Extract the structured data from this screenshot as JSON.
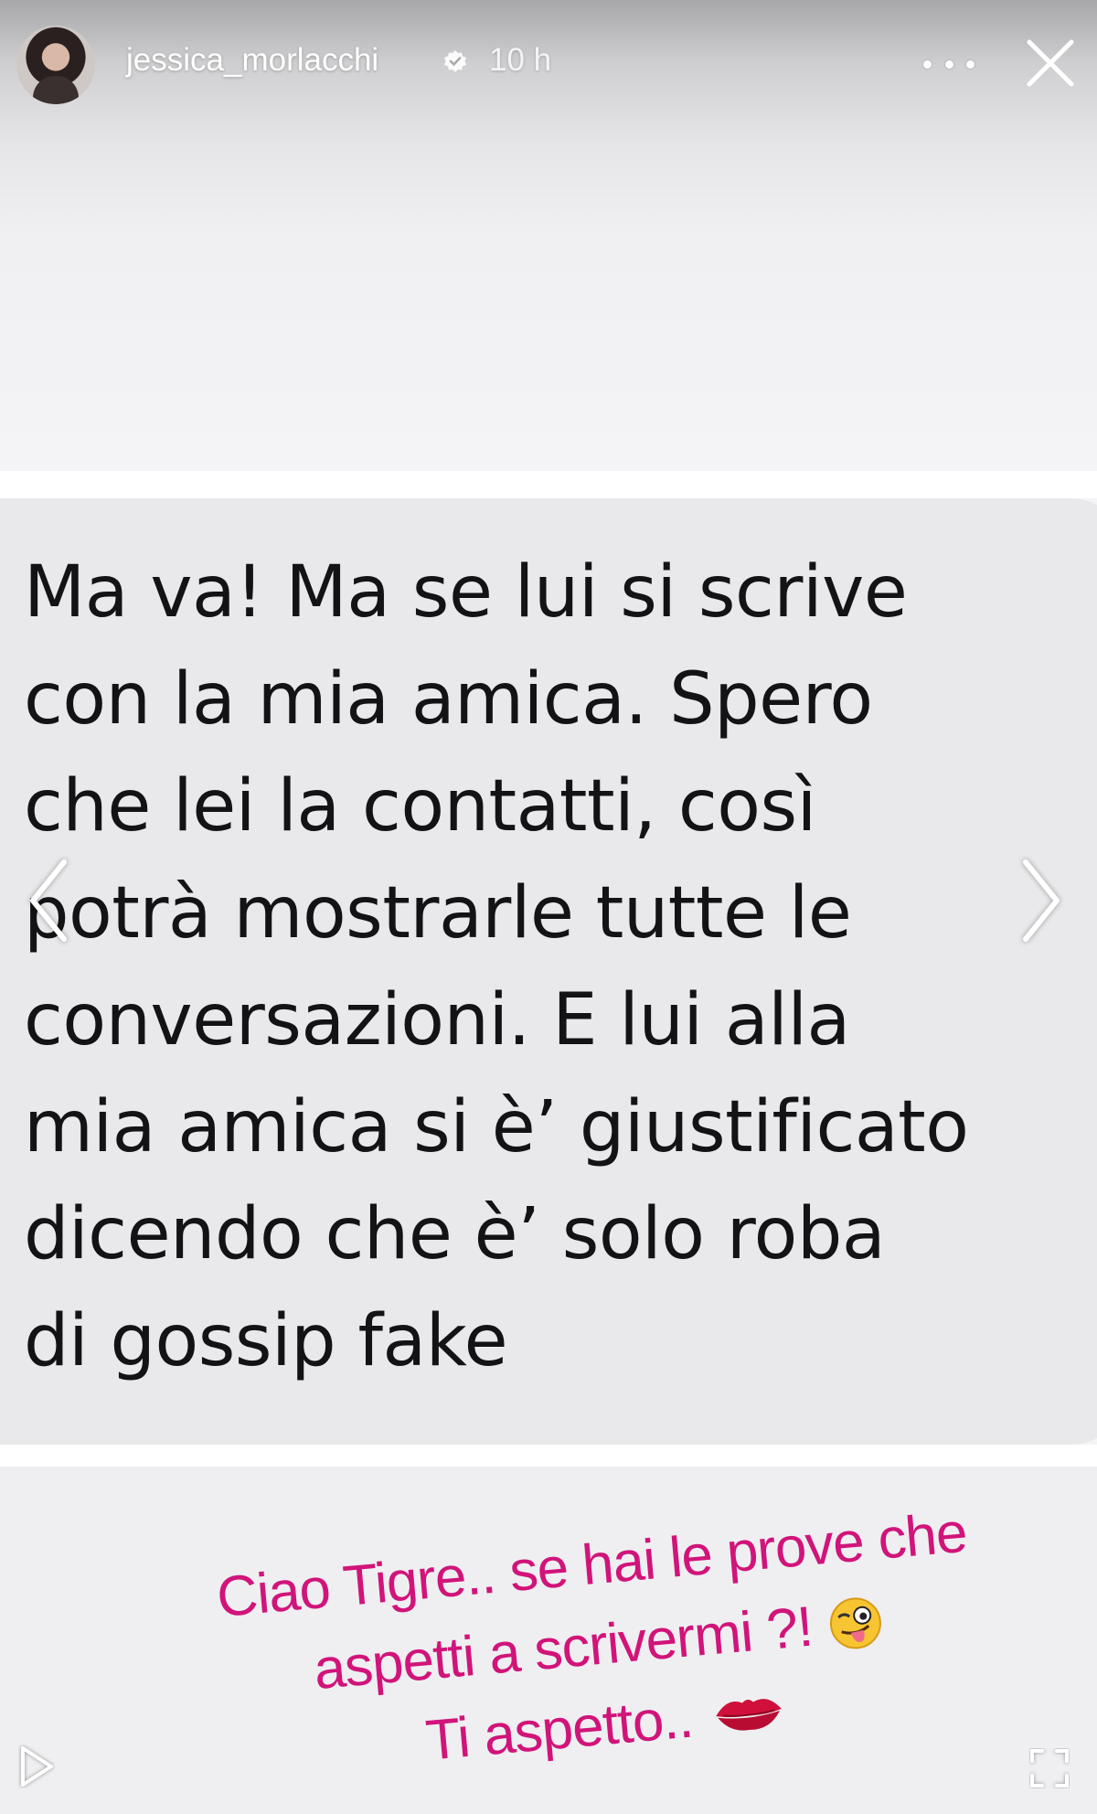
{
  "header": {
    "username": "jessica_morlacchi",
    "time": "10 h",
    "verified": true,
    "avatar_icon": "profile-photo",
    "more_icon": "more-horizontal-icon",
    "close_icon": "close-icon"
  },
  "message": {
    "text": "Ma va! Ma se lui si scrive\ncon la mia amica. Spero\nche lei la contatti, così\npotrà mostrarle tutte le\nconversazioni. E lui alla\nmia amica si è’ giustificato\ndicendo che è’ solo roba\ndi gossip fake"
  },
  "caption": {
    "line1": "Ciao Tigre.. se hai le prove che",
    "line2": "aspetti a scrivermi ?!",
    "line3": "Ti aspetto..",
    "line2_emoji": "winking-face-tongue",
    "line3_emoji": "kiss-mark",
    "color": "#d1147a"
  },
  "controls": {
    "prev_icon": "chevron-left-icon",
    "next_icon": "chevron-right-icon",
    "play_icon": "play-icon",
    "expand_icon": "fullscreen-icon"
  }
}
